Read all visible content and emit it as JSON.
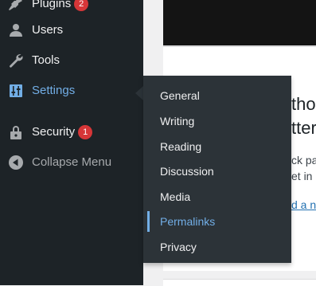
{
  "sidebar": {
    "items": [
      {
        "id": "plugins",
        "label": "Plugins",
        "icon": "plugin-icon",
        "badge": "2"
      },
      {
        "id": "users",
        "label": "Users",
        "icon": "user-icon"
      },
      {
        "id": "tools",
        "label": "Tools",
        "icon": "wrench-icon"
      },
      {
        "id": "settings",
        "label": "Settings",
        "icon": "sliders-icon",
        "current": true
      },
      {
        "id": "security",
        "label": "Security",
        "icon": "lock-icon",
        "badge": "1"
      },
      {
        "id": "collapse",
        "label": "Collapse Menu",
        "icon": "collapse-arrow-icon"
      }
    ]
  },
  "submenu": {
    "items": [
      {
        "label": "General"
      },
      {
        "label": "Writing"
      },
      {
        "label": "Reading"
      },
      {
        "label": "Discussion"
      },
      {
        "label": "Media"
      },
      {
        "label": "Permalinks",
        "current": true
      },
      {
        "label": "Privacy"
      }
    ]
  },
  "content": {
    "fragments": {
      "line1": "tho",
      "line2": "tter",
      "line3": "ck pa",
      "line4": "et in",
      "link": "d a ne"
    }
  },
  "colors": {
    "sidebar_bg": "#1d2327",
    "submenu_bg": "#2c3338",
    "accent": "#72aee6",
    "badge": "#d63638"
  }
}
